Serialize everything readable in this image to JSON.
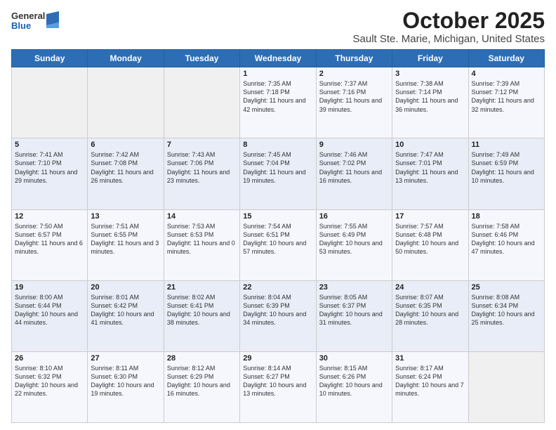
{
  "logo": {
    "general": "General",
    "blue": "Blue"
  },
  "title": "October 2025",
  "subtitle": "Sault Ste. Marie, Michigan, United States",
  "days_of_week": [
    "Sunday",
    "Monday",
    "Tuesday",
    "Wednesday",
    "Thursday",
    "Friday",
    "Saturday"
  ],
  "weeks": [
    [
      {
        "day": "",
        "info": ""
      },
      {
        "day": "",
        "info": ""
      },
      {
        "day": "",
        "info": ""
      },
      {
        "day": "1",
        "info": "Sunrise: 7:35 AM\nSunset: 7:18 PM\nDaylight: 11 hours and 42 minutes."
      },
      {
        "day": "2",
        "info": "Sunrise: 7:37 AM\nSunset: 7:16 PM\nDaylight: 11 hours and 39 minutes."
      },
      {
        "day": "3",
        "info": "Sunrise: 7:38 AM\nSunset: 7:14 PM\nDaylight: 11 hours and 36 minutes."
      },
      {
        "day": "4",
        "info": "Sunrise: 7:39 AM\nSunset: 7:12 PM\nDaylight: 11 hours and 32 minutes."
      }
    ],
    [
      {
        "day": "5",
        "info": "Sunrise: 7:41 AM\nSunset: 7:10 PM\nDaylight: 11 hours and 29 minutes."
      },
      {
        "day": "6",
        "info": "Sunrise: 7:42 AM\nSunset: 7:08 PM\nDaylight: 11 hours and 26 minutes."
      },
      {
        "day": "7",
        "info": "Sunrise: 7:43 AM\nSunset: 7:06 PM\nDaylight: 11 hours and 23 minutes."
      },
      {
        "day": "8",
        "info": "Sunrise: 7:45 AM\nSunset: 7:04 PM\nDaylight: 11 hours and 19 minutes."
      },
      {
        "day": "9",
        "info": "Sunrise: 7:46 AM\nSunset: 7:02 PM\nDaylight: 11 hours and 16 minutes."
      },
      {
        "day": "10",
        "info": "Sunrise: 7:47 AM\nSunset: 7:01 PM\nDaylight: 11 hours and 13 minutes."
      },
      {
        "day": "11",
        "info": "Sunrise: 7:49 AM\nSunset: 6:59 PM\nDaylight: 11 hours and 10 minutes."
      }
    ],
    [
      {
        "day": "12",
        "info": "Sunrise: 7:50 AM\nSunset: 6:57 PM\nDaylight: 11 hours and 6 minutes."
      },
      {
        "day": "13",
        "info": "Sunrise: 7:51 AM\nSunset: 6:55 PM\nDaylight: 11 hours and 3 minutes."
      },
      {
        "day": "14",
        "info": "Sunrise: 7:53 AM\nSunset: 6:53 PM\nDaylight: 11 hours and 0 minutes."
      },
      {
        "day": "15",
        "info": "Sunrise: 7:54 AM\nSunset: 6:51 PM\nDaylight: 10 hours and 57 minutes."
      },
      {
        "day": "16",
        "info": "Sunrise: 7:55 AM\nSunset: 6:49 PM\nDaylight: 10 hours and 53 minutes."
      },
      {
        "day": "17",
        "info": "Sunrise: 7:57 AM\nSunset: 6:48 PM\nDaylight: 10 hours and 50 minutes."
      },
      {
        "day": "18",
        "info": "Sunrise: 7:58 AM\nSunset: 6:46 PM\nDaylight: 10 hours and 47 minutes."
      }
    ],
    [
      {
        "day": "19",
        "info": "Sunrise: 8:00 AM\nSunset: 6:44 PM\nDaylight: 10 hours and 44 minutes."
      },
      {
        "day": "20",
        "info": "Sunrise: 8:01 AM\nSunset: 6:42 PM\nDaylight: 10 hours and 41 minutes."
      },
      {
        "day": "21",
        "info": "Sunrise: 8:02 AM\nSunset: 6:41 PM\nDaylight: 10 hours and 38 minutes."
      },
      {
        "day": "22",
        "info": "Sunrise: 8:04 AM\nSunset: 6:39 PM\nDaylight: 10 hours and 34 minutes."
      },
      {
        "day": "23",
        "info": "Sunrise: 8:05 AM\nSunset: 6:37 PM\nDaylight: 10 hours and 31 minutes."
      },
      {
        "day": "24",
        "info": "Sunrise: 8:07 AM\nSunset: 6:35 PM\nDaylight: 10 hours and 28 minutes."
      },
      {
        "day": "25",
        "info": "Sunrise: 8:08 AM\nSunset: 6:34 PM\nDaylight: 10 hours and 25 minutes."
      }
    ],
    [
      {
        "day": "26",
        "info": "Sunrise: 8:10 AM\nSunset: 6:32 PM\nDaylight: 10 hours and 22 minutes."
      },
      {
        "day": "27",
        "info": "Sunrise: 8:11 AM\nSunset: 6:30 PM\nDaylight: 10 hours and 19 minutes."
      },
      {
        "day": "28",
        "info": "Sunrise: 8:12 AM\nSunset: 6:29 PM\nDaylight: 10 hours and 16 minutes."
      },
      {
        "day": "29",
        "info": "Sunrise: 8:14 AM\nSunset: 6:27 PM\nDaylight: 10 hours and 13 minutes."
      },
      {
        "day": "30",
        "info": "Sunrise: 8:15 AM\nSunset: 6:26 PM\nDaylight: 10 hours and 10 minutes."
      },
      {
        "day": "31",
        "info": "Sunrise: 8:17 AM\nSunset: 6:24 PM\nDaylight: 10 hours and 7 minutes."
      },
      {
        "day": "",
        "info": ""
      }
    ]
  ]
}
